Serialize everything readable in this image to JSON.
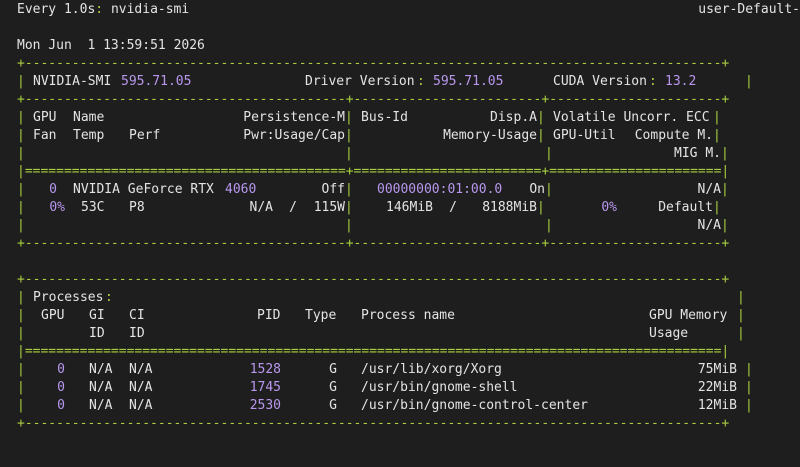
{
  "watch": {
    "interval_label": "Every 1.0s",
    "colon": ":",
    "command": "nvidia-smi",
    "host": "user-Default-"
  },
  "timestamp": {
    "day_month": "Mon Jun  1",
    "time": "13:59:51",
    "year": "2026"
  },
  "borders": {
    "outer": "+-----------------------------------------------------------------------------------------+",
    "gpu_sections": "+-----------------------------------------+------------------------+----------------------+",
    "gpu_double": "|=========================================+========================+======================|",
    "proc_double": "|=========================================================================================|"
  },
  "smi": {
    "label": "NVIDIA-SMI",
    "version": "595.71.05",
    "driver_label": "Driver Version",
    "driver_version": "595.71.05",
    "cuda_label": "CUDA Version",
    "cuda_version": "13.2"
  },
  "gpu_header": {
    "gpu": "GPU",
    "name": "Name",
    "persistence": "Persistence-M",
    "bus_id": "Bus-Id",
    "disp": "Disp.A",
    "volatile": "Volatile Uncorr. ECC",
    "fan": "Fan",
    "temp": "Temp",
    "perf": "Perf",
    "pwr": "Pwr:Usage/Cap",
    "memory_usage": "Memory-Usage",
    "gpu_util": "GPU-Util",
    "compute": "Compute M.",
    "mig": "MIG M."
  },
  "gpu": {
    "index": "0",
    "name_prefix": "NVIDIA GeForce RTX",
    "model_number": "4060",
    "persistence": "Off",
    "bus_id": "00000000:01:00.0",
    "disp": "On",
    "ecc": "N/A",
    "fan": "0%",
    "temp": "53C",
    "perf": "P8",
    "pwr_usage": "N/A",
    "pwr_cap": "115W",
    "mem_used": "146MiB",
    "mem_total": "8188MiB",
    "gpu_util": "0%",
    "compute_mode": "Default",
    "mig": "N/A"
  },
  "processes": {
    "title": "Processes",
    "headers": {
      "gpu": "GPU",
      "gi": "GI",
      "ci": "CI",
      "pid": "PID",
      "type": "Type",
      "process_name": "Process name",
      "gpu_memory": "GPU Memory",
      "gi_id": "ID",
      "ci_id": "ID",
      "usage": "Usage"
    },
    "rows": [
      {
        "gpu": "0",
        "gi": "N/A",
        "ci": "N/A",
        "pid": "1528",
        "type": "G",
        "name": "/usr/lib/xorg/Xorg",
        "memory": "75MiB"
      },
      {
        "gpu": "0",
        "gi": "N/A",
        "ci": "N/A",
        "pid": "1745",
        "type": "G",
        "name": "/usr/bin/gnome-shell",
        "memory": "22MiB"
      },
      {
        "gpu": "0",
        "gi": "N/A",
        "ci": "N/A",
        "pid": "2530",
        "type": "G",
        "name": "/usr/bin/gnome-control-center",
        "memory": "12MiB"
      }
    ]
  },
  "colors": {
    "background": "#1e1e1e",
    "text": "#e4e4e4",
    "separator": "#a8cf3f",
    "number": "#b897ee"
  }
}
